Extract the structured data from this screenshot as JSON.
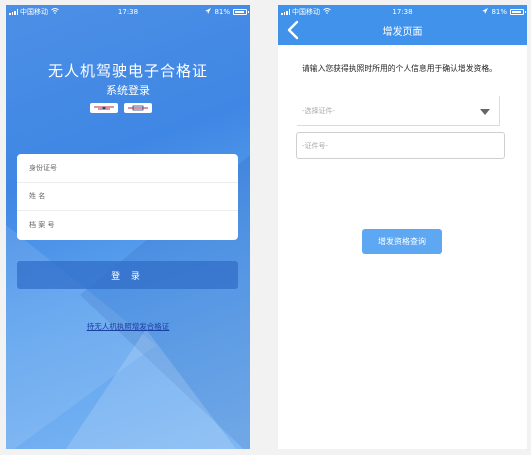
{
  "status_bar": {
    "carrier": "中国移动",
    "time": "17:38",
    "battery": "81%"
  },
  "login_screen": {
    "title": "无人机驾驶电子合格证",
    "subtitle": "系统登录",
    "fields": [
      {
        "label": "身份证号"
      },
      {
        "label": "姓 名"
      },
      {
        "label": "档 案 号"
      }
    ],
    "login_label": "登 录",
    "reissue_link": "持无人机执照增发合格证"
  },
  "reissue_screen": {
    "nav_title": "增发页面",
    "prompt": "请输入您获得执照时所用的个人信息用于确认增发资格。",
    "select_placeholder": "-选择证件-",
    "id_placeholder": "-证件号-",
    "query_label": "增发资格查询"
  },
  "colors": {
    "nav_blue": "#4192ea",
    "button_blue": "#5ea7f2",
    "link_color": "#1a3fa0"
  }
}
